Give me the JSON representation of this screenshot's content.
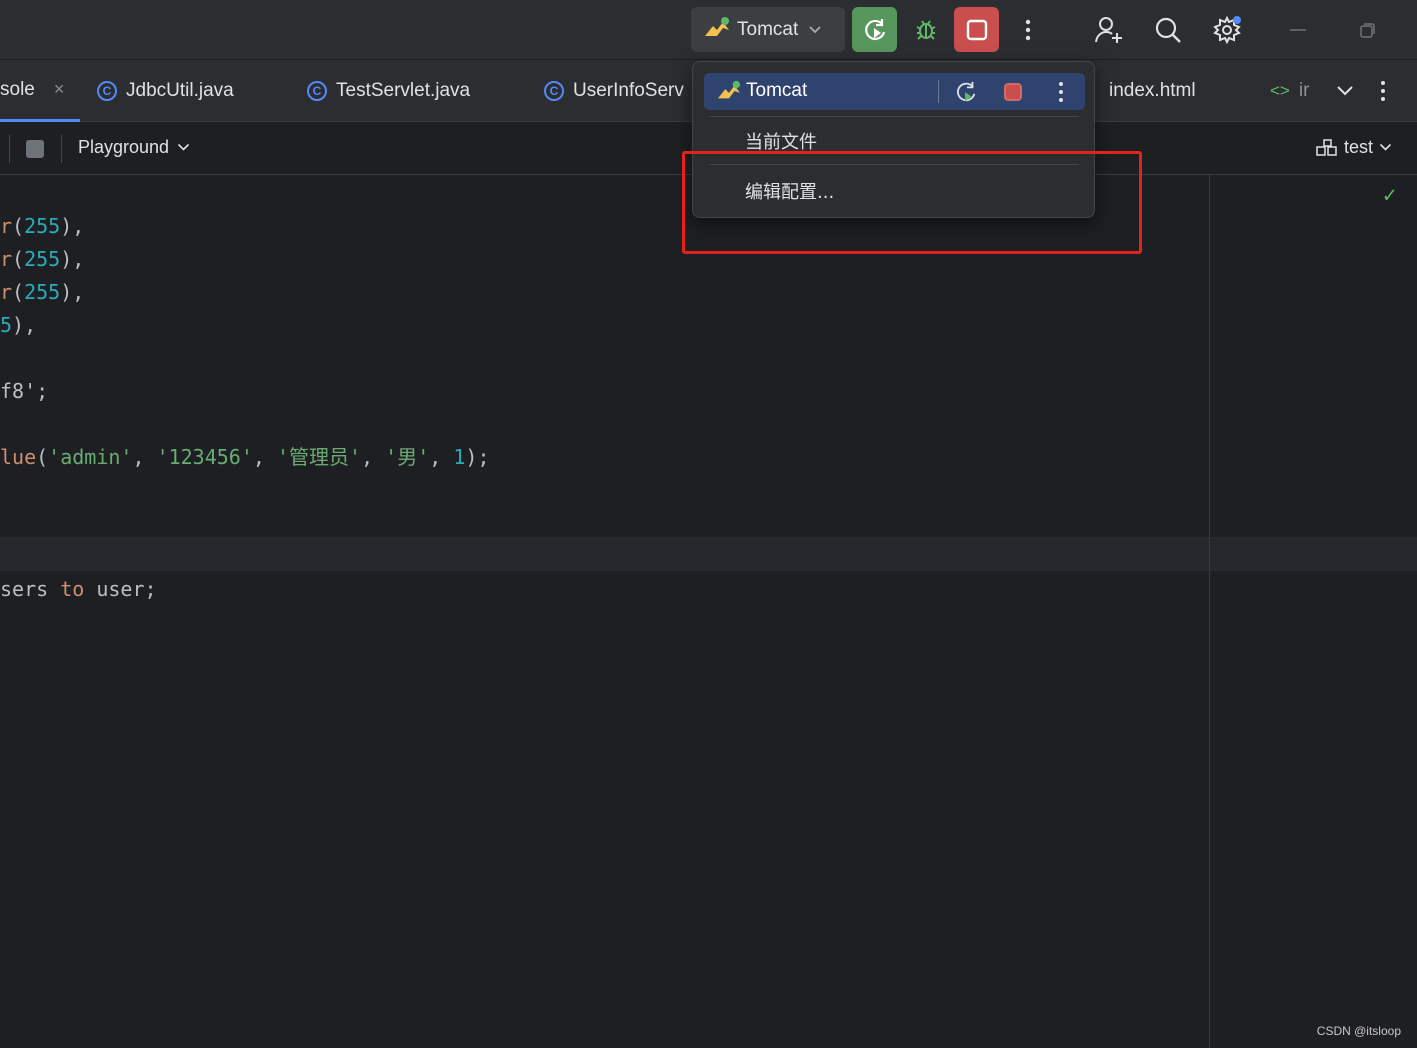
{
  "titlebar": {
    "run_config": "Tomcat",
    "icons": [
      "tomcat-icon",
      "chevron-down-icon",
      "rerun-icon",
      "debug-icon",
      "stop-icon",
      "more-icon",
      "user-add-icon",
      "search-icon",
      "settings-icon",
      "minimize-icon",
      "restore-icon"
    ]
  },
  "tabs": [
    {
      "label": "sole",
      "close": "×"
    },
    {
      "label": "JdbcUtil.java"
    },
    {
      "label": "TestServlet.java"
    },
    {
      "label": "UserInfoServ"
    },
    {
      "label": "index.html"
    },
    {
      "label": "ir"
    }
  ],
  "toolbar": {
    "playground": "Playground",
    "schema": "test"
  },
  "editor": {
    "lines": [
      {
        "parts": [
          {
            "t": "r",
            "c": "kw"
          },
          {
            "t": "(",
            "c": ""
          },
          {
            "t": "255",
            "c": "num"
          },
          {
            "t": "),",
            "c": ""
          }
        ]
      },
      {
        "parts": [
          {
            "t": "r",
            "c": "kw"
          },
          {
            "t": "(",
            "c": ""
          },
          {
            "t": "255",
            "c": "num"
          },
          {
            "t": "),",
            "c": ""
          }
        ]
      },
      {
        "parts": [
          {
            "t": "r",
            "c": "kw"
          },
          {
            "t": "(",
            "c": ""
          },
          {
            "t": "255",
            "c": "num"
          },
          {
            "t": "),",
            "c": ""
          }
        ]
      },
      {
        "parts": [
          {
            "t": "5",
            "c": "num"
          },
          {
            "t": "),",
            "c": ""
          }
        ]
      },
      {
        "parts": [
          {
            "t": "f8';",
            "c": ""
          }
        ]
      },
      {
        "parts": [
          {
            "t": "lue",
            "c": "kw"
          },
          {
            "t": "(",
            "c": ""
          },
          {
            "t": "'admin'",
            "c": "str"
          },
          {
            "t": ", ",
            "c": ""
          },
          {
            "t": "'123456'",
            "c": "str"
          },
          {
            "t": ", ",
            "c": ""
          },
          {
            "t": "'管理员'",
            "c": "str"
          },
          {
            "t": ", ",
            "c": ""
          },
          {
            "t": "'男'",
            "c": "str"
          },
          {
            "t": ", ",
            "c": ""
          },
          {
            "t": "1",
            "c": "num"
          },
          {
            "t": ");",
            "c": ""
          }
        ]
      },
      {
        "parts": [
          {
            "t": "sers ",
            "c": ""
          },
          {
            "t": "to",
            "c": "kw"
          },
          {
            "t": " user;",
            "c": ""
          }
        ]
      }
    ]
  },
  "popup": {
    "selected": "Tomcat",
    "current_file": "当前文件",
    "edit_config": "编辑配置..."
  },
  "watermark": "CSDN @itsloop",
  "colors": {
    "accent": "#548af7",
    "run_green": "#57965c",
    "stop_red": "#c94f4f",
    "annotation": "#e2231a"
  }
}
